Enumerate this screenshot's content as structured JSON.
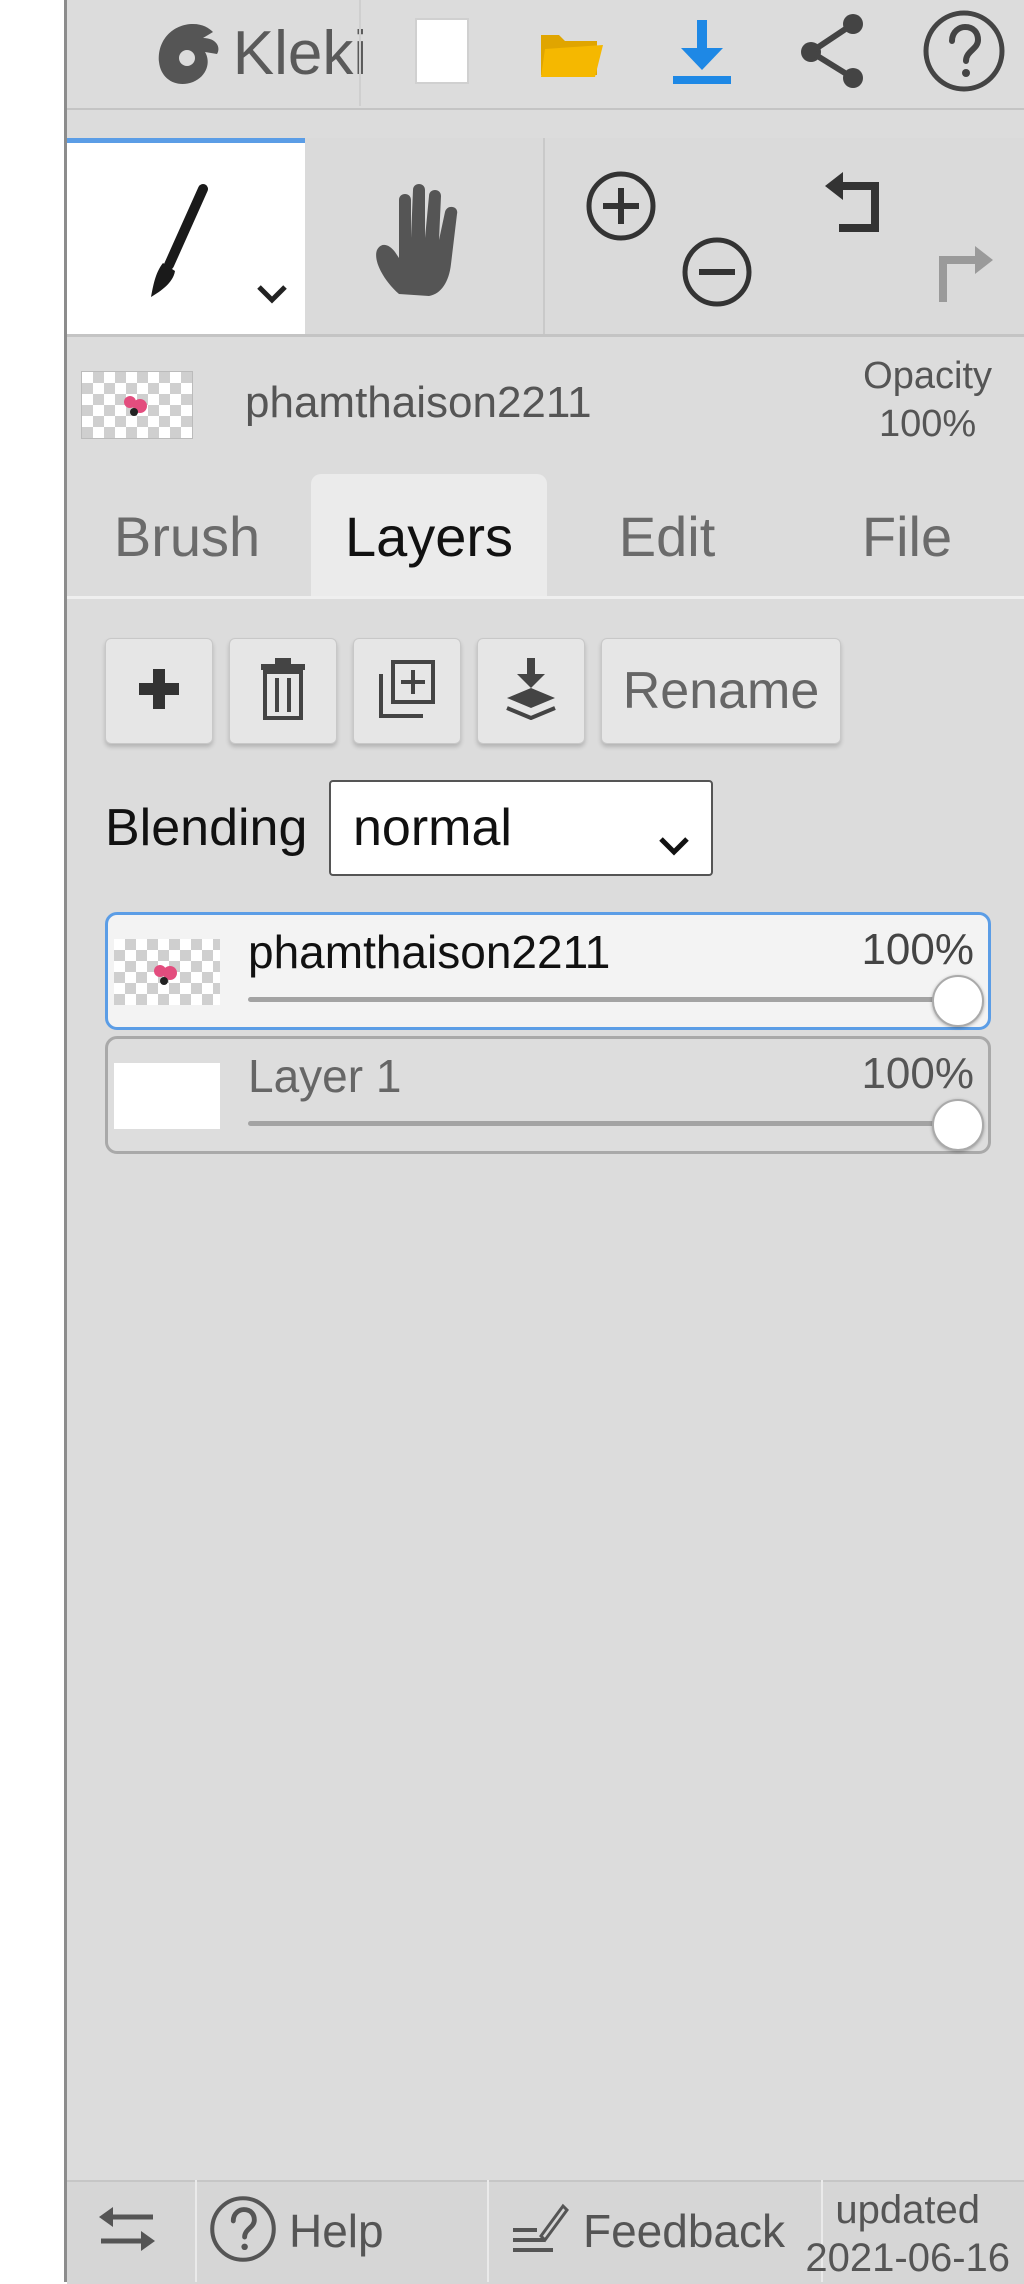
{
  "header": {
    "logo_text": "Kleki",
    "icons": [
      "kleki-logo-icon",
      "new-image-icon",
      "open-folder-icon",
      "download-icon",
      "share-icon",
      "help-icon"
    ]
  },
  "tools": {
    "icons": [
      "brush-tool-icon",
      "hand-tool-icon",
      "zoom-in-icon",
      "zoom-out-icon",
      "undo-icon",
      "redo-icon"
    ]
  },
  "layer_info": {
    "name": "phamthaison2211",
    "opacity_label": "Opacity",
    "opacity_value": "100%"
  },
  "tabs": [
    {
      "label": "Brush",
      "active": false
    },
    {
      "label": "Layers",
      "active": true
    },
    {
      "label": "Edit",
      "active": false
    },
    {
      "label": "File",
      "active": false
    }
  ],
  "layer_buttons": {
    "icons": [
      "add-layer-icon",
      "delete-layer-icon",
      "duplicate-layer-icon",
      "merge-down-icon"
    ],
    "rename_label": "Rename"
  },
  "blending": {
    "label": "Blending",
    "value": "normal"
  },
  "layers": [
    {
      "name": "phamthaison2211",
      "opacity": "100%",
      "opacity_fraction": 1.0,
      "selected": true
    },
    {
      "name": "Layer 1",
      "opacity": "100%",
      "opacity_fraction": 1.0,
      "selected": false
    }
  ],
  "footer": {
    "help_label": "Help",
    "feedback_label": "Feedback",
    "updated_label": "updated",
    "updated_date": "2021-06-16"
  },
  "colors": {
    "accent": "#5b9de6",
    "download_icon": "#1e88e5",
    "folder_icon": "#f5b800"
  }
}
